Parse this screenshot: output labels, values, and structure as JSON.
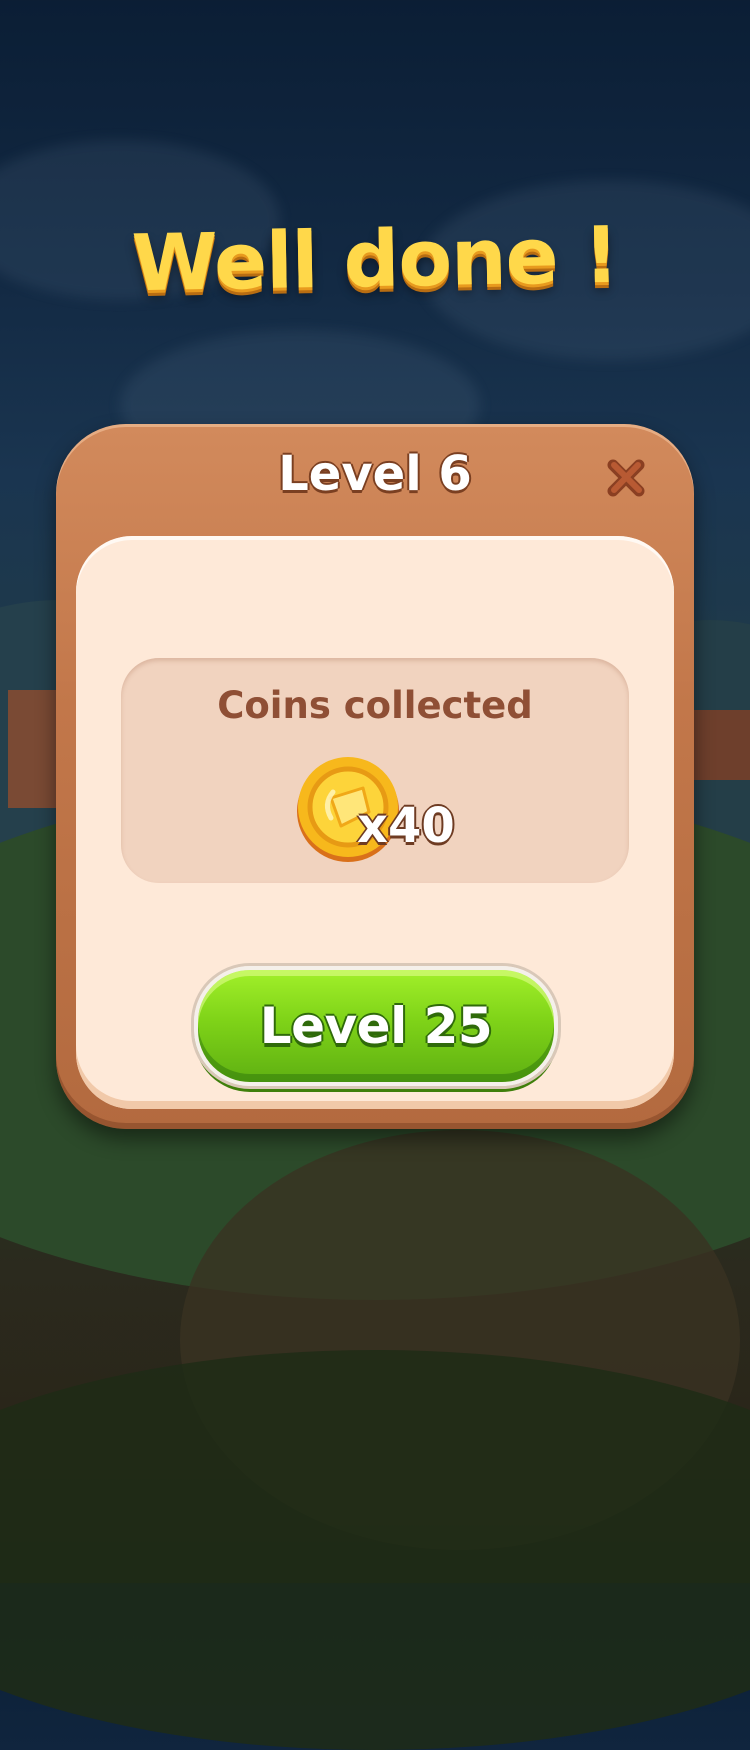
{
  "header": {
    "headline": "Well done !"
  },
  "dialog": {
    "title": "Level 6",
    "close_icon": "close-icon",
    "coins": {
      "label": "Coins collected",
      "icon": "coin-icon",
      "count": "x40"
    },
    "next_button_label": "Level 25"
  },
  "colors": {
    "headline": "#ffd84a",
    "wood_frame": "#c2774a",
    "panel": "#fee9d8",
    "coins_box": "#f1d3bf",
    "coins_label": "#8f4f35",
    "button_green": "#7fd318"
  }
}
